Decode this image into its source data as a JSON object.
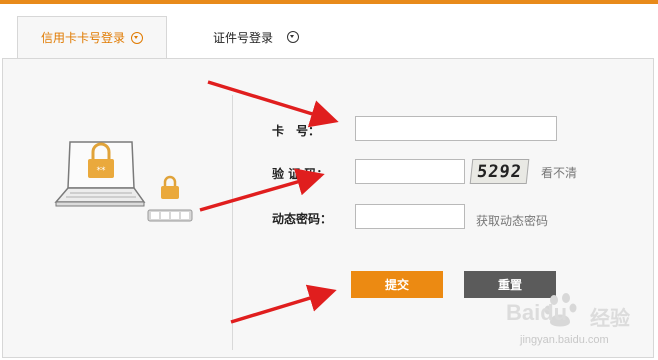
{
  "tabs": [
    {
      "label": "信用卡卡号登录",
      "active": true
    },
    {
      "label": "证件号登录",
      "active": false
    }
  ],
  "form": {
    "card_label": "卡　号：",
    "card_value": "",
    "captcha_label": "验 证 码：",
    "captcha_value": "",
    "captcha_text": "5292",
    "captcha_refresh": "看不清",
    "otp_label": "动态密码：",
    "otp_value": "",
    "otp_get": "获取动态密码"
  },
  "buttons": {
    "submit": "提交",
    "reset": "重置"
  },
  "watermark": {
    "brand": "Baidu",
    "sub": "经验",
    "url": "jingyan.baidu.com"
  },
  "colors": {
    "accent": "#e88a1a",
    "arrow": "#e01e1e",
    "reset": "#5b5b5b"
  }
}
